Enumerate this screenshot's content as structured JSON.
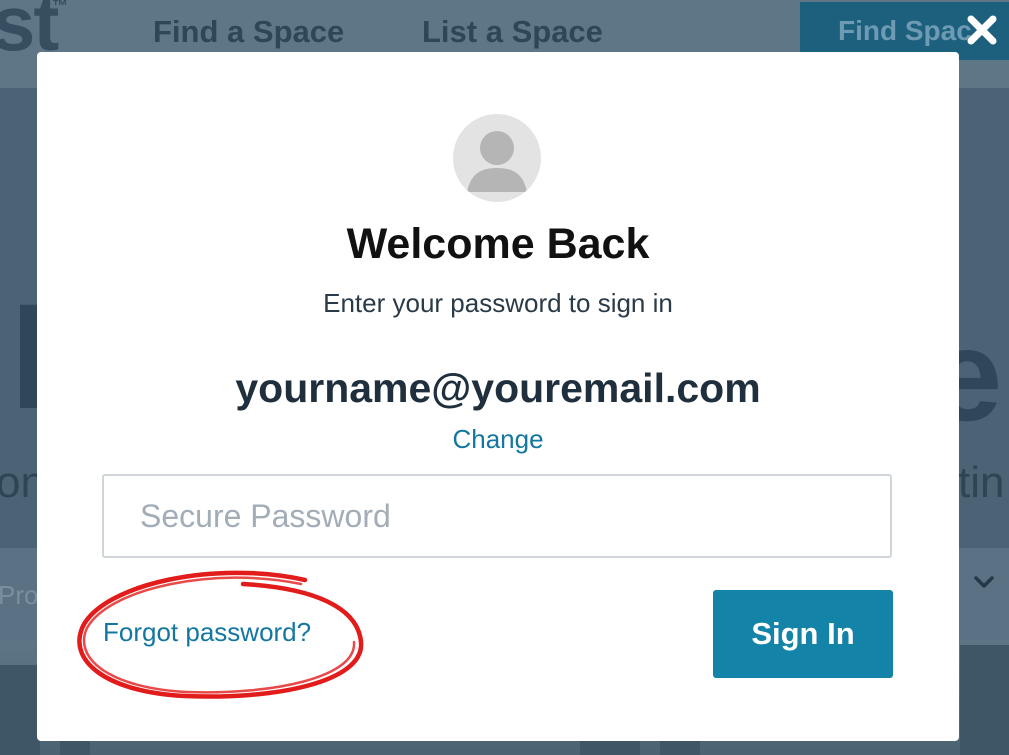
{
  "background": {
    "logo_text": "st",
    "logo_tm": "™",
    "nav": {
      "find_space": "Find a Space",
      "list_space": "List a Space",
      "cta": "Find Spac"
    },
    "hero_left": "F",
    "hero_right": "e",
    "subtext_left": "on",
    "subtext_right": "tin",
    "search_bar_text": "Pro"
  },
  "modal": {
    "title": "Welcome Back",
    "subtitle": "Enter your password to sign in",
    "email": "yourname@youremail.com",
    "change_label": "Change",
    "password_placeholder": "Secure Password",
    "password_value": "",
    "forgot_label": "Forgot password?",
    "signin_label": "Sign In"
  },
  "icons": {
    "close": "close-icon",
    "avatar": "user-avatar-icon",
    "chevron": "chevron-down-icon"
  },
  "colors": {
    "accent": "#1483a8",
    "link": "#1477a0",
    "annotation": "#e21b1b"
  }
}
